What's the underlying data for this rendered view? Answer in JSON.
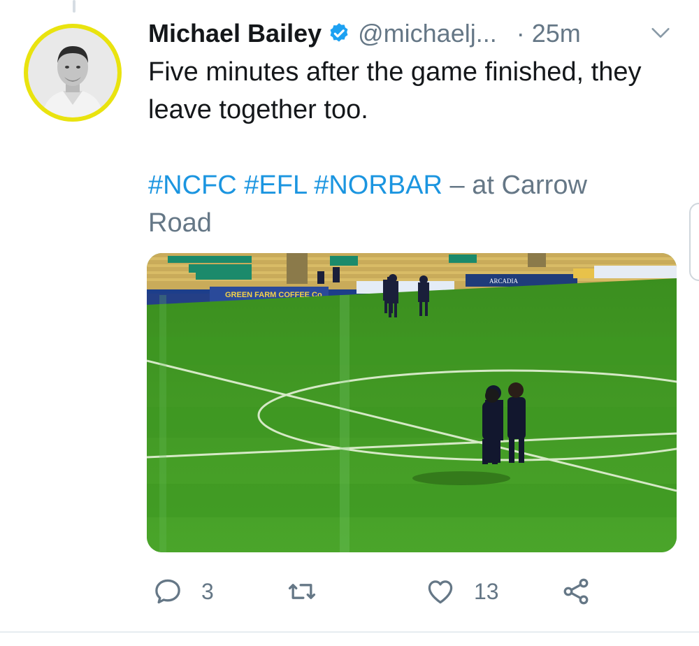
{
  "tweet": {
    "author_name": "Michael Bailey",
    "author_handle": "@michaelj...",
    "time": "· 25m",
    "text": "Five minutes after the game finished, they leave together too.",
    "hashtags": [
      "#NCFC",
      "#EFL",
      "#NORBAR"
    ],
    "location_text": "– at Carrow Road",
    "media": {
      "ad_board_1": "GREEN FARM COFFEE Co",
      "ad_board_2": "ARCADIA"
    },
    "replies": "3",
    "retweets": "",
    "likes": "13"
  },
  "icons": {
    "verified": "verified-badge-icon",
    "menu": "chevron-down-icon",
    "reply": "reply-icon",
    "retweet": "retweet-icon",
    "like": "heart-icon",
    "share": "share-icon"
  },
  "colors": {
    "link": "#1b95e0",
    "secondary": "#657786",
    "primary_text": "#14171a",
    "avatar_ring": "#e9e30f",
    "pitch": "#3f9a22"
  }
}
